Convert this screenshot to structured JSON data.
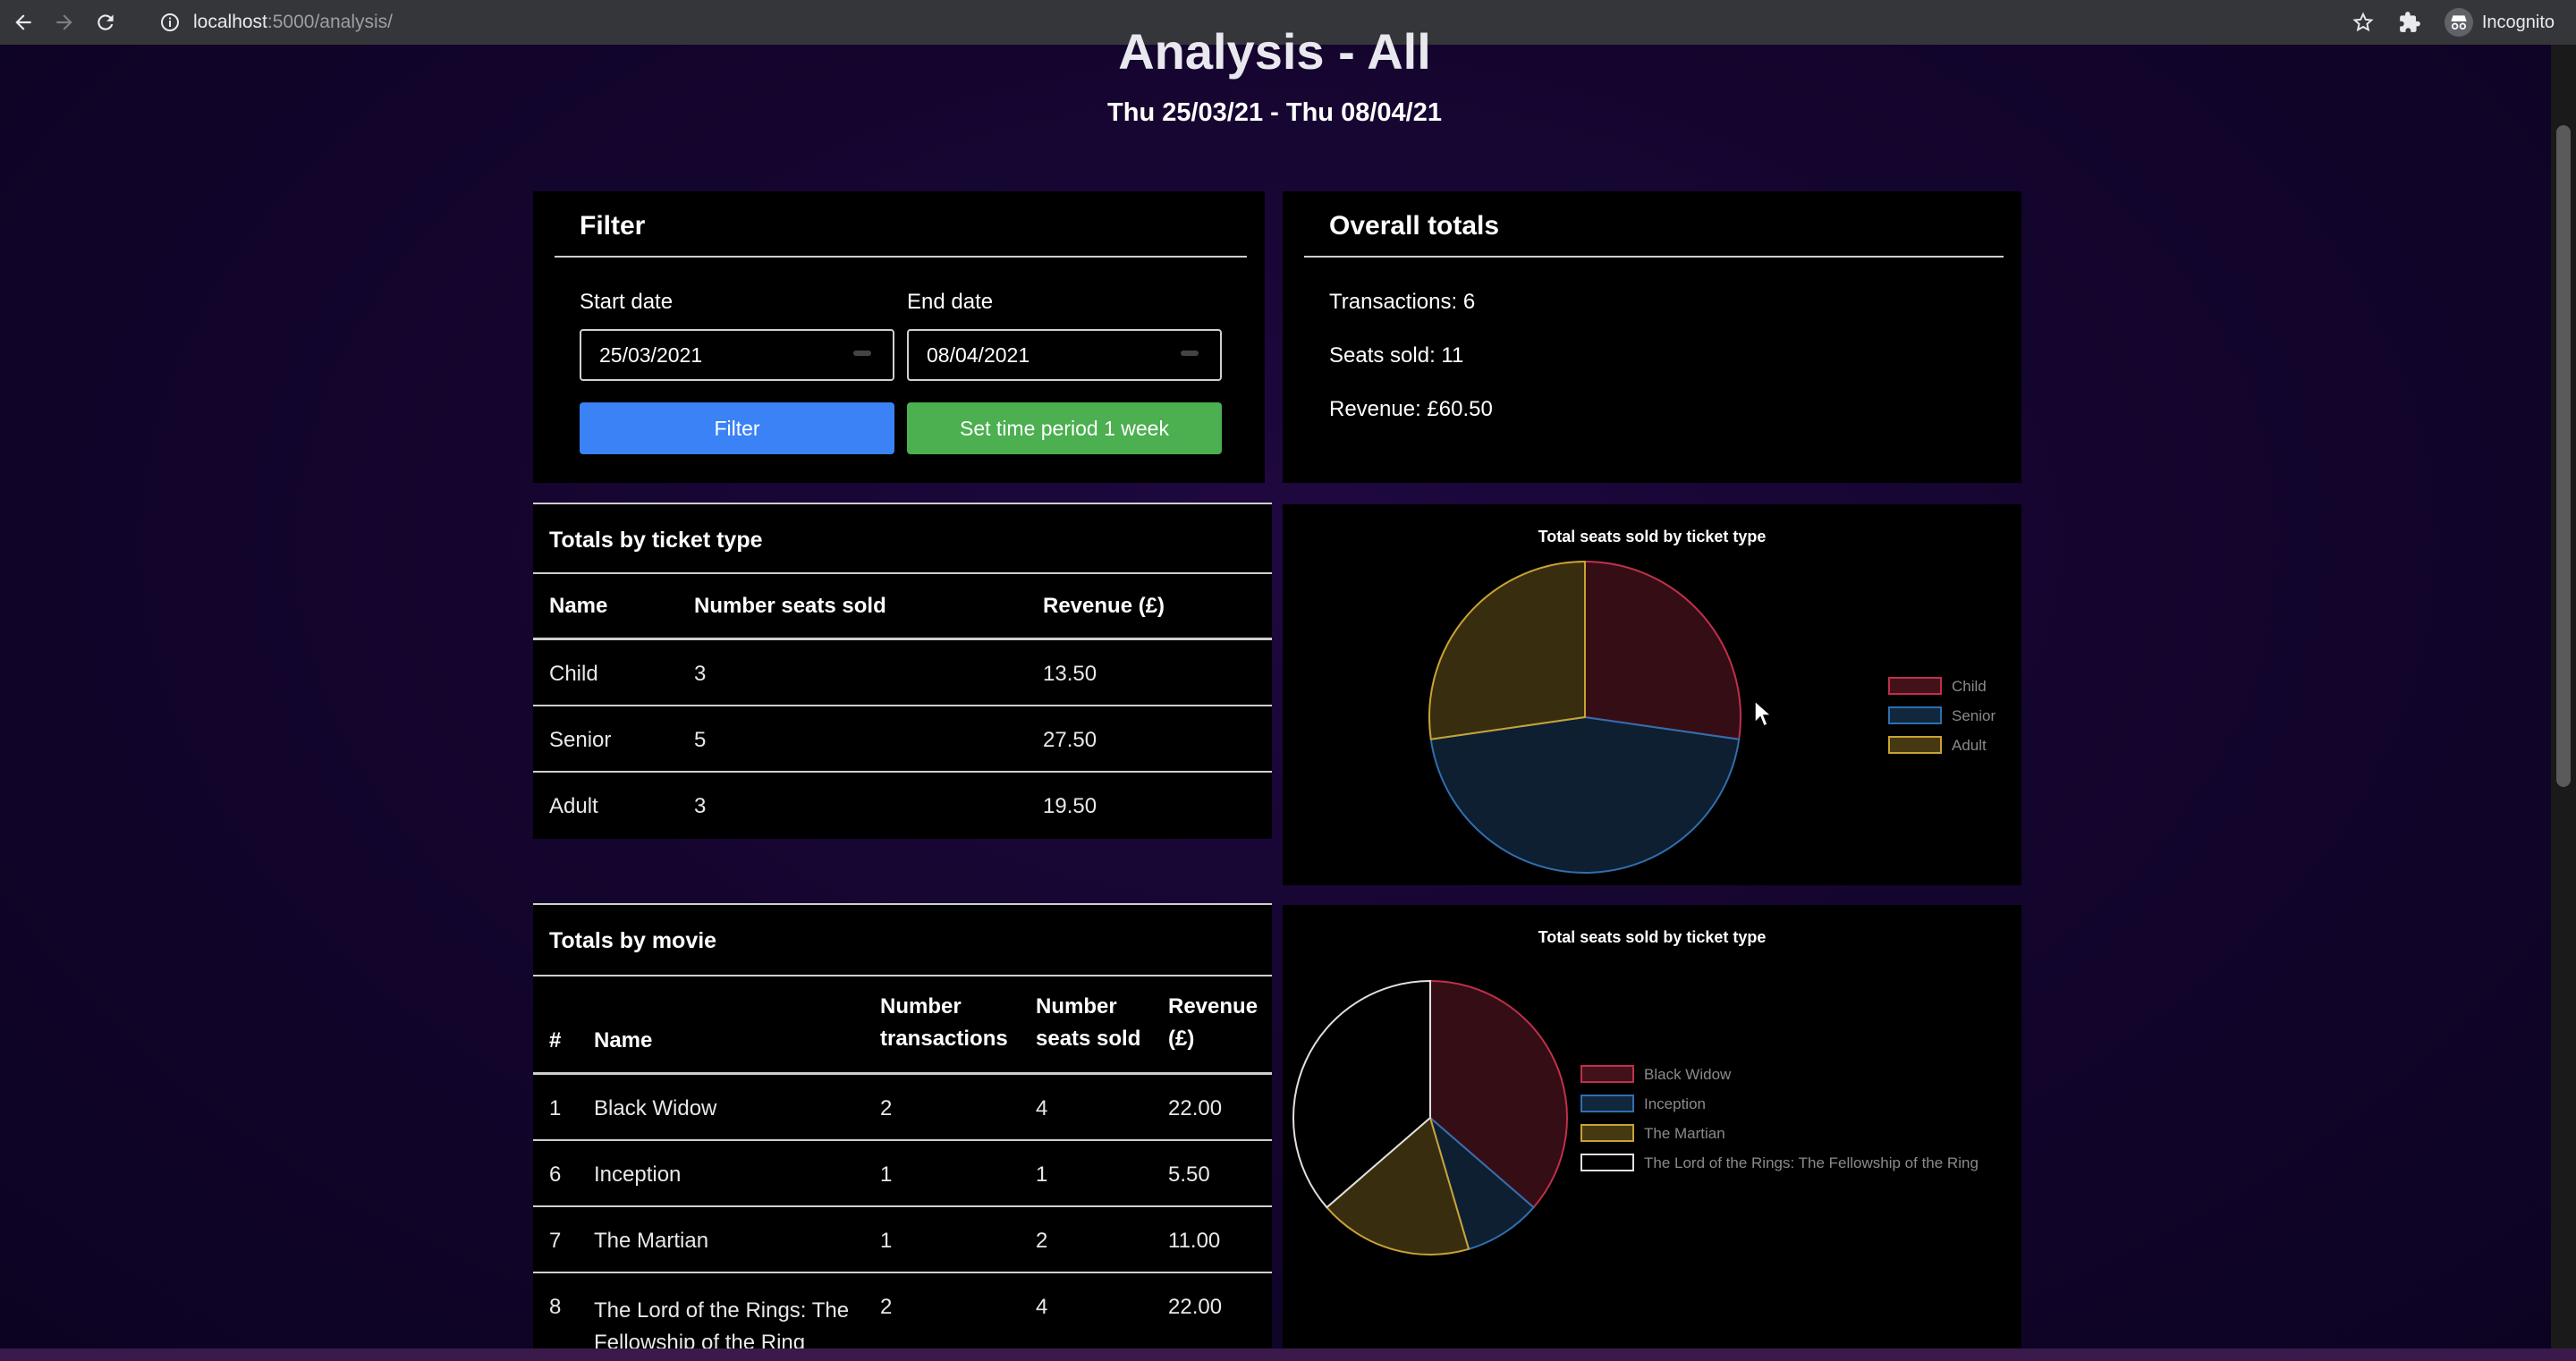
{
  "browser": {
    "url_host": "localhost",
    "url_rest": ":5000/analysis/",
    "profile_label": "Incognito"
  },
  "page": {
    "title": "Analysis - All",
    "subtitle": "Thu 25/03/21 - Thu 08/04/21"
  },
  "filter": {
    "heading": "Filter",
    "start_label": "Start date",
    "start_value": "25/03/2021",
    "end_label": "End date",
    "end_value": "08/04/2021",
    "filter_button": "Filter",
    "week_button": "Set time period 1 week"
  },
  "overall": {
    "heading": "Overall totals",
    "transactions": "Transactions: 6",
    "seats": "Seats sold: 11",
    "revenue": "Revenue: £60.50"
  },
  "ticket_table": {
    "title": "Totals by ticket type",
    "headers": [
      "Name",
      "Number seats sold",
      "Revenue (£)"
    ],
    "rows": [
      [
        "Child",
        "3",
        "13.50"
      ],
      [
        "Senior",
        "5",
        "27.50"
      ],
      [
        "Adult",
        "3",
        "19.50"
      ]
    ]
  },
  "movie_table": {
    "title": "Totals by movie",
    "headers": [
      "#",
      "Name",
      "Number transactions",
      "Number seats sold",
      "Revenue (£)"
    ],
    "rows": [
      [
        "1",
        "Black Widow",
        "2",
        "4",
        "22.00"
      ],
      [
        "6",
        "Inception",
        "1",
        "1",
        "5.50"
      ],
      [
        "7",
        "The Martian",
        "1",
        "2",
        "11.00"
      ],
      [
        "8",
        "The Lord of the Rings: The Fellowship of the Ring",
        "2",
        "4",
        "22.00"
      ]
    ]
  },
  "colors": {
    "red": "#c0304a",
    "blue": "#2f6fb0",
    "yellow": "#c9a233",
    "white": "#e0e0e0"
  },
  "chart_data": [
    {
      "type": "pie",
      "title": "Total seats sold by ticket type",
      "categories": [
        "Child",
        "Senior",
        "Adult"
      ],
      "values": [
        3,
        5,
        3
      ],
      "legend": "right"
    },
    {
      "type": "pie",
      "title": "Total seats sold by ticket type",
      "categories": [
        "Black Widow",
        "Inception",
        "The Martian",
        "The Lord of the Rings: The Fellowship of the Ring"
      ],
      "values": [
        4,
        1,
        2,
        4
      ],
      "legend": "right"
    }
  ]
}
